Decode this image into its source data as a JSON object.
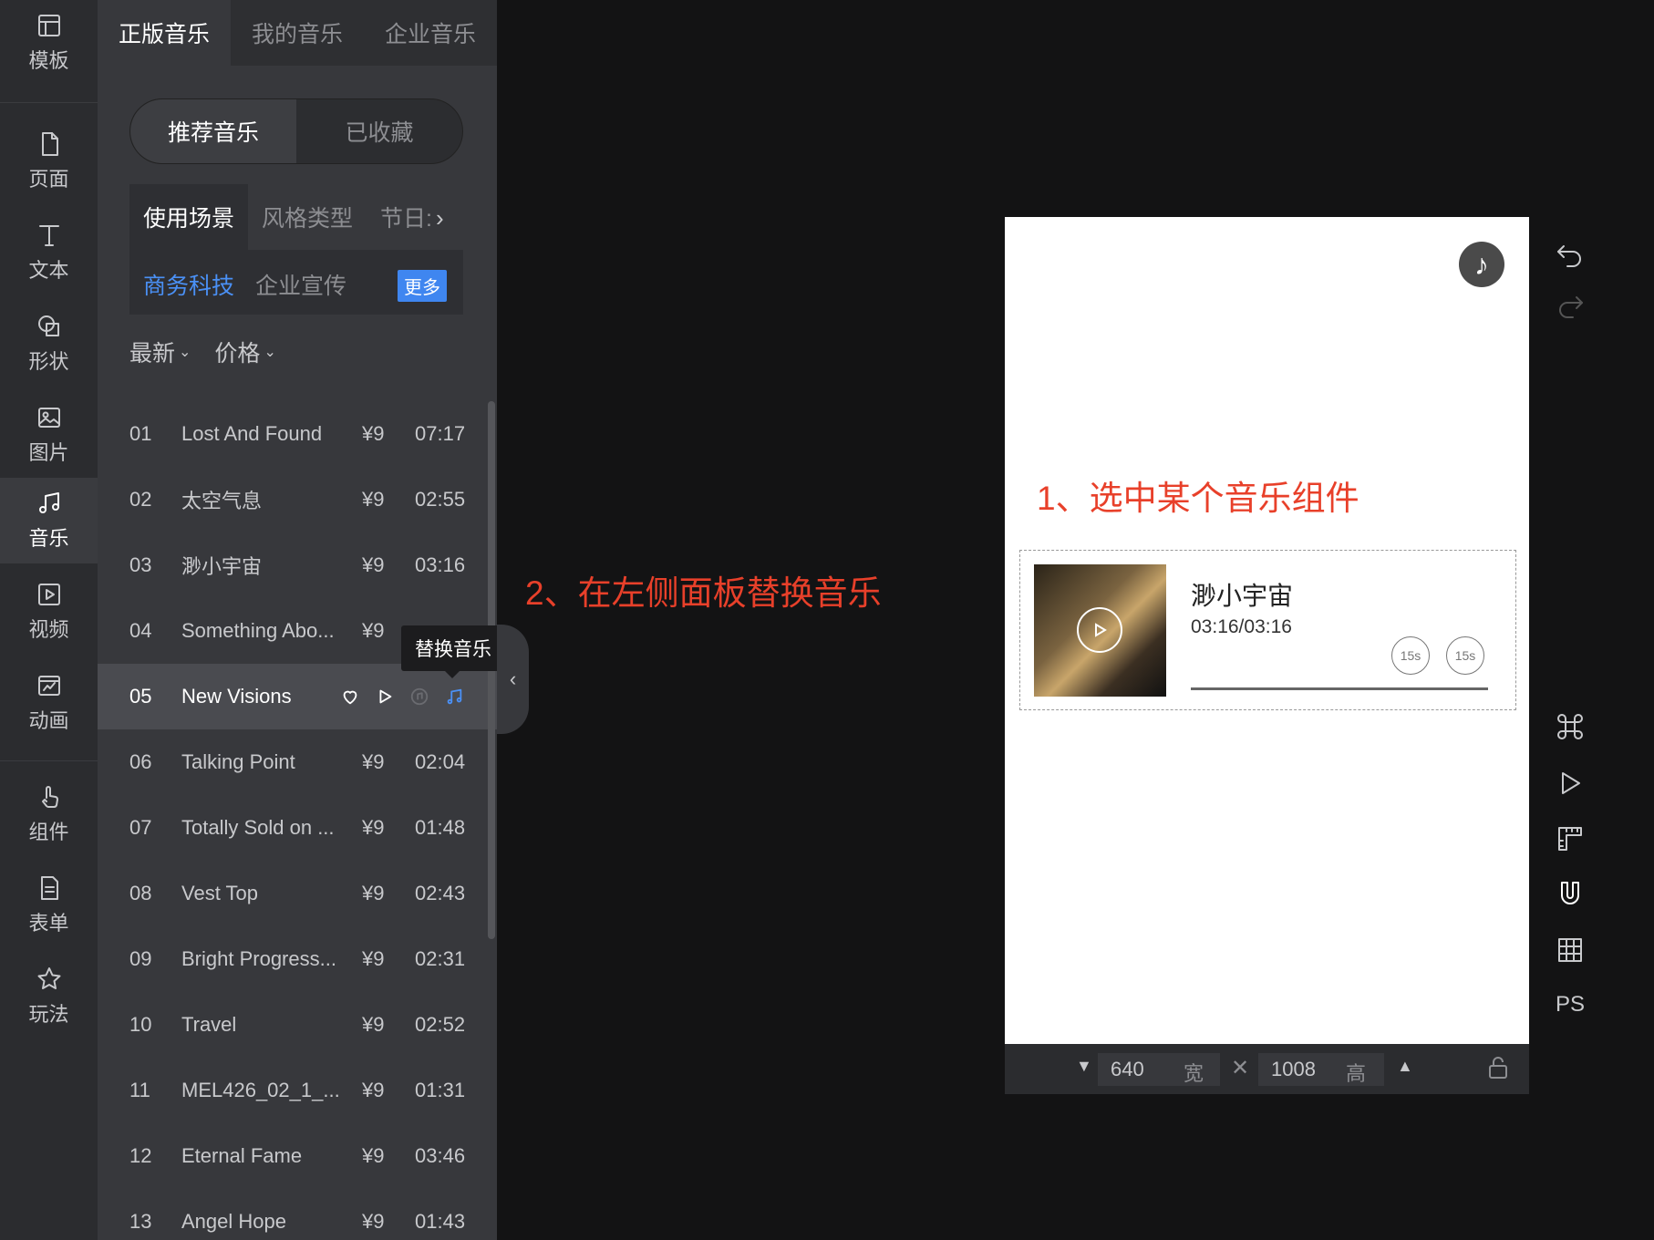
{
  "rail": {
    "items": [
      {
        "label": "模板"
      },
      {
        "label": "页面"
      },
      {
        "label": "文本"
      },
      {
        "label": "形状"
      },
      {
        "label": "图片"
      },
      {
        "label": "音乐"
      },
      {
        "label": "视频"
      },
      {
        "label": "动画"
      },
      {
        "label": "组件"
      },
      {
        "label": "表单"
      },
      {
        "label": "玩法"
      }
    ],
    "active_index": 5
  },
  "panel": {
    "tabs": [
      {
        "label": "正版音乐"
      },
      {
        "label": "我的音乐"
      },
      {
        "label": "企业音乐"
      }
    ],
    "segment": [
      {
        "label": "推荐音乐"
      },
      {
        "label": "已收藏"
      }
    ],
    "categories": [
      {
        "label": "使用场景"
      },
      {
        "label": "风格类型"
      },
      {
        "label": "节日:"
      }
    ],
    "sub_tags": [
      {
        "label": "商务科技"
      },
      {
        "label": "企业宣传"
      }
    ],
    "more_label": "更多",
    "sorters": [
      {
        "label": "最新"
      },
      {
        "label": "价格"
      }
    ],
    "tracks": [
      {
        "num": "01",
        "title": "Lost And Found",
        "price": "¥9",
        "duration": "07:17"
      },
      {
        "num": "02",
        "title": "太空气息",
        "price": "¥9",
        "duration": "02:55"
      },
      {
        "num": "03",
        "title": "渺小宇宙",
        "price": "¥9",
        "duration": "03:16"
      },
      {
        "num": "04",
        "title": "Something Abo...",
        "price": "¥9",
        "duration": ""
      },
      {
        "num": "05",
        "title": "New Visions",
        "price": "",
        "duration": ""
      },
      {
        "num": "06",
        "title": "Talking Point",
        "price": "¥9",
        "duration": "02:04"
      },
      {
        "num": "07",
        "title": "Totally Sold on ...",
        "price": "¥9",
        "duration": "01:48"
      },
      {
        "num": "08",
        "title": "Vest Top",
        "price": "¥9",
        "duration": "02:43"
      },
      {
        "num": "09",
        "title": "Bright Progress...",
        "price": "¥9",
        "duration": "02:31"
      },
      {
        "num": "10",
        "title": "Travel",
        "price": "¥9",
        "duration": "02:52"
      },
      {
        "num": "11",
        "title": "MEL426_02_1_...",
        "price": "¥9",
        "duration": "01:31"
      },
      {
        "num": "12",
        "title": "Eternal Fame",
        "price": "¥9",
        "duration": "03:46"
      },
      {
        "num": "13",
        "title": "Angel Hope",
        "price": "¥9",
        "duration": "01:43"
      }
    ],
    "active_track_index": 4,
    "tooltip": "替换音乐"
  },
  "annotations": {
    "step1": "1、选中某个音乐组件",
    "step2": "2、在左侧面板替换音乐"
  },
  "player": {
    "title": "渺小宇宙",
    "time": "03:16/03:16",
    "skip_back": "15s",
    "skip_forward": "15s",
    "progress": 1.0
  },
  "canvas_size": {
    "width_value": "640",
    "width_unit": "宽",
    "height_value": "1008",
    "height_unit": "高"
  },
  "tools": {
    "ps_label": "PS"
  },
  "colors": {
    "annotation": "#e8402a",
    "accent": "#4a90f5"
  }
}
